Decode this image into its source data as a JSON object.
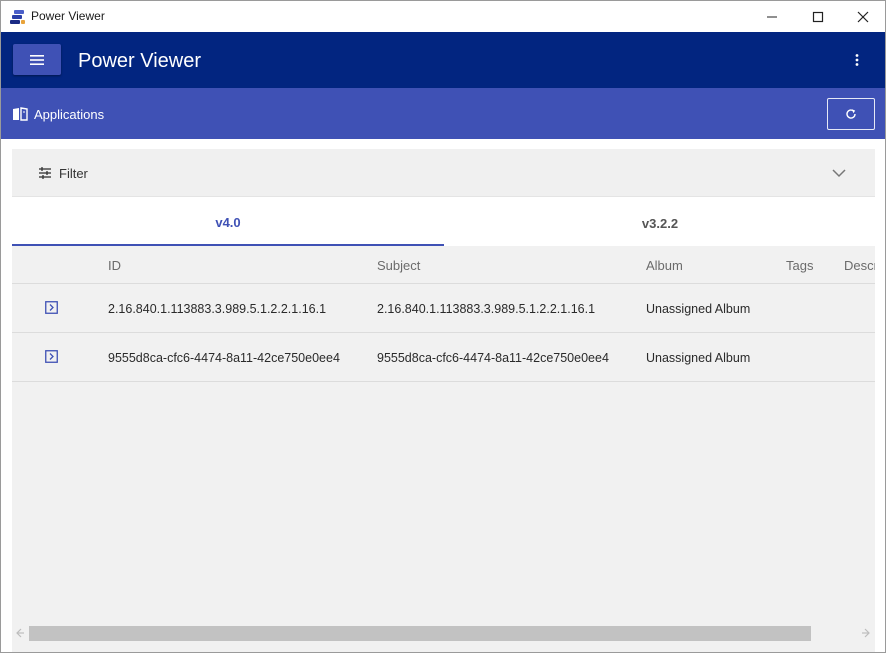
{
  "window": {
    "title": "Power Viewer"
  },
  "header": {
    "title": "Power Viewer",
    "menu_icon": "hamburger-icon",
    "more_icon": "kebab-icon"
  },
  "subheader": {
    "title": "Applications",
    "icon": "book-icon",
    "refresh_icon": "refresh-icon"
  },
  "filter": {
    "label": "Filter"
  },
  "tabs": [
    {
      "label": "v4.0",
      "selected": true
    },
    {
      "label": "v3.2.2",
      "selected": false
    }
  ],
  "table": {
    "columns": [
      "ID",
      "Subject",
      "Album",
      "Tags",
      "Descr"
    ],
    "rows": [
      {
        "id": "2.16.840.1.113883.3.989.5.1.2.2.1.16.1",
        "subject": "2.16.840.1.113883.3.989.5.1.2.2.1.16.1",
        "album": "Unassigned Album"
      },
      {
        "id": "9555d8ca-cfc6-4474-8a11-42ce750e0ee4",
        "subject": "9555d8ca-cfc6-4474-8a11-42ce750e0ee4",
        "album": "Unassigned Album"
      }
    ]
  },
  "colors": {
    "appbar": "#022580",
    "subbar": "#3f51b5",
    "accent": "#3f51b5"
  }
}
